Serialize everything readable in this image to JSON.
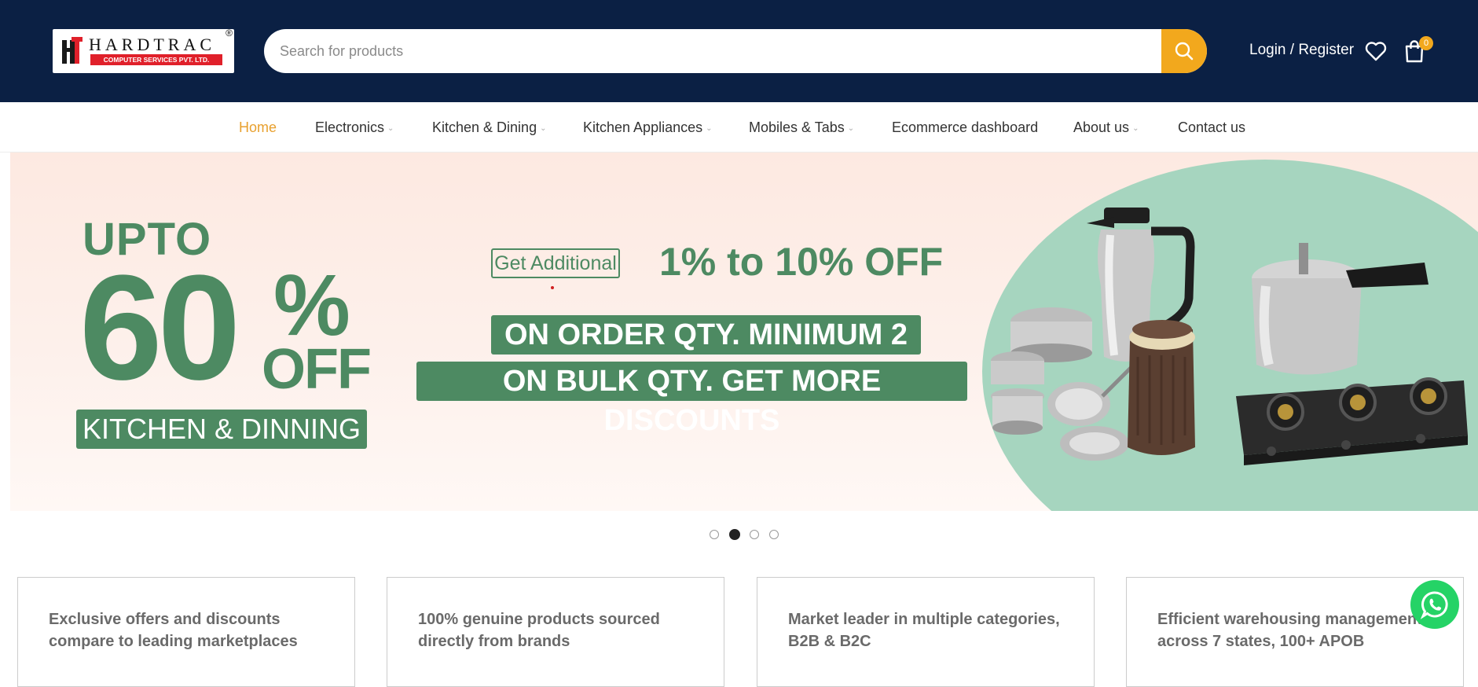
{
  "header": {
    "logo": {
      "name": "HARDTRAC",
      "registered": "®",
      "tagline": "COMPUTER SERVICES PVT. LTD."
    },
    "search": {
      "placeholder": "Search for products",
      "value": ""
    },
    "login_label": "Login / Register",
    "cart_count": "0",
    "accent_color": "#f2a81d",
    "background_color": "#0b2044",
    "icons": [
      "search-icon",
      "heart-icon",
      "cart-icon"
    ]
  },
  "nav": {
    "items": [
      {
        "label": "Home",
        "active": true,
        "has_dropdown": false
      },
      {
        "label": "Electronics",
        "has_dropdown": true
      },
      {
        "label": "Kitchen & Dining",
        "has_dropdown": true
      },
      {
        "label": "Kitchen Appliances",
        "has_dropdown": true
      },
      {
        "label": "Mobiles & Tabs",
        "has_dropdown": true
      },
      {
        "label": "Ecommerce dashboard",
        "has_dropdown": false
      },
      {
        "label": "About us",
        "has_dropdown": true
      },
      {
        "label": "Contact us",
        "has_dropdown": false
      }
    ]
  },
  "banner": {
    "upto": "UPTO",
    "big_number": "60",
    "percent": "%",
    "off": "OFF",
    "category": "KITCHEN & DINNING",
    "get_additional": "Get Additional",
    "range_off": "1% to 10% OFF",
    "line1": "ON ORDER QTY. MINIMUM 2",
    "line2": "ON BULK QTY. GET MORE DISCOUNTS",
    "green": "#4d8a62",
    "mint": "#a6d5bf"
  },
  "slider": {
    "count": 4,
    "active_index": 1
  },
  "features": [
    "Exclusive offers and discounts compare to leading marketplaces",
    "100% genuine products sourced directly from brands",
    "Market leader in multiple categories, B2B & B2C",
    "Efficient warehousing management across 7 states, 100+ APOB"
  ],
  "whatsapp_icon": "whatsapp-icon"
}
